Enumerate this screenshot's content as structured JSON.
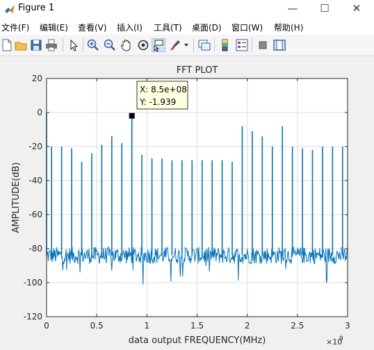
{
  "window": {
    "title": "Figure 1",
    "minimize": "—",
    "maximize": "☐",
    "close": "✕"
  },
  "menu": [
    {
      "label": "文件(F)"
    },
    {
      "label": "编辑(E)"
    },
    {
      "label": "查看(V)"
    },
    {
      "label": "插入(I)"
    },
    {
      "label": "工具(T)"
    },
    {
      "label": "桌面(D)"
    },
    {
      "label": "窗口(W)"
    },
    {
      "label": "帮助(H)"
    }
  ],
  "toolbar": {
    "icons": [
      "new-figure-icon",
      "open-file-icon",
      "save-icon",
      "print-icon",
      "edit-plot-arrow-icon",
      "zoom-in-icon",
      "zoom-out-icon",
      "pan-hand-icon",
      "rotate-3d-icon",
      "data-cursor-icon",
      "brush-icon",
      "brush-dropdown-icon",
      "link-plot-icon",
      "colorbar-icon",
      "legend-icon",
      "hide-plot-tools-icon",
      "show-plot-tools-icon"
    ]
  },
  "colors": {
    "line": "#0072BD",
    "grid": "#dcdcdc",
    "axis": "#262626",
    "tooltip_bg": "#ffffe1"
  },
  "chart_data": {
    "type": "line",
    "title": "FFT PLOT",
    "xlabel": "data output FREQUENCY(MHz)",
    "ylabel": "AMPLITUDE(dB)",
    "xlim": [
      0,
      3000000000
    ],
    "ylim": [
      -120,
      20
    ],
    "x_exponent_label": "×10",
    "x_exponent_power": "9",
    "xticks": [
      0,
      0.5,
      1,
      1.5,
      2,
      2.5,
      3
    ],
    "xtick_labels": [
      "0",
      "0.5",
      "1",
      "1.5",
      "2",
      "2.5",
      "3"
    ],
    "yticks": [
      20,
      0,
      -20,
      -40,
      -60,
      -80,
      -100,
      -120
    ],
    "ytick_labels": [
      "20",
      "0",
      "-20",
      "-40",
      "-60",
      "-80",
      "-100",
      "-120"
    ],
    "grid": true,
    "noise_floor_db": -84,
    "noise_spread_db": 5,
    "series": [
      {
        "x": [
          0,
          50000000,
          150000000,
          250000000,
          350000000,
          450000000,
          550000000,
          650000000,
          750000000,
          850000000,
          950000000,
          1050000000,
          1150000000,
          1250000000,
          1350000000,
          1450000000,
          1550000000,
          1650000000,
          1750000000,
          1850000000,
          1950000000,
          2050000000,
          2150000000,
          2250000000,
          2350000000,
          2450000000,
          2550000000,
          2650000000,
          2750000000,
          2850000000,
          2950000000
        ],
        "y": [
          0,
          -20,
          -20,
          -21,
          -29,
          -24,
          -19,
          -14,
          -18,
          -1.9,
          -25,
          -27,
          -27,
          -28,
          -28,
          -28,
          -28,
          -28,
          -28,
          -29,
          -8,
          -11,
          -14,
          -20,
          -8,
          -20,
          -21,
          -22,
          -20,
          -20,
          -20
        ]
      }
    ],
    "marker": {
      "x": 850000000,
      "y": -1.939
    },
    "datatip": {
      "x_text": "X: 8.5e+08",
      "y_text": "Y: -1.939"
    }
  }
}
